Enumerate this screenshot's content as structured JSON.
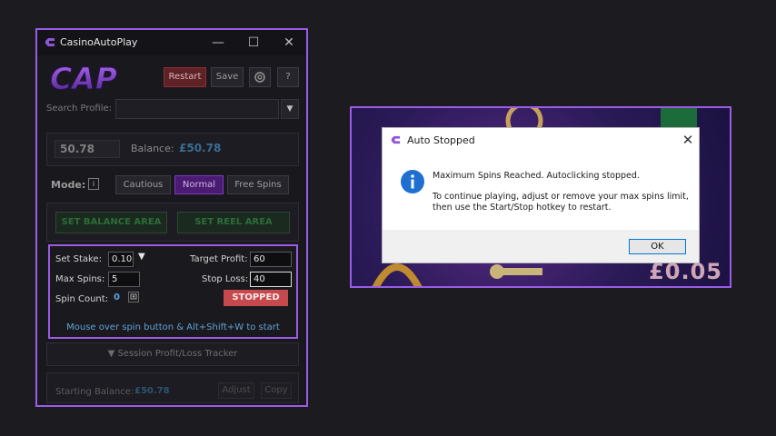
{
  "app": {
    "title": "CasinoAutoPlay",
    "logo_text": "CAP",
    "window_controls": {
      "minimize": "—",
      "maximize": "☐",
      "close": "✕"
    },
    "toolbar": {
      "restart": "Restart",
      "save": "Save",
      "gear_icon": "gear-icon",
      "help": "?"
    },
    "search": {
      "label": "Search Profile:",
      "value": "",
      "dropdown_icon": "▼"
    },
    "balance": {
      "box_value": "50.78",
      "label": "Balance:",
      "value": "£50.78"
    },
    "mode": {
      "label": "Mode:",
      "info": "i",
      "options": [
        "Cautious",
        "Normal",
        "Free Spins"
      ],
      "selected": "Normal"
    },
    "areas": {
      "balance_button": "SET BALANCE AREA",
      "reel_button": "SET REEL AREA"
    },
    "settings": {
      "stake_label": "Set Stake:",
      "stake_value": "0.10",
      "stake_dd_icon": "▼",
      "target_label": "Target Profit:",
      "target_value": "60",
      "max_spins_label": "Max Spins:",
      "max_spins_value": "5",
      "stop_loss_label": "Stop Loss:",
      "stop_loss_value": "40",
      "spin_count_label": "Spin Count:",
      "spin_count_value": "0",
      "status_button": "STOPPED",
      "hint": "Mouse over spin button & Alt+Shift+W to start"
    },
    "tracker": {
      "label": "▼ Session Profit/Loss Tracker"
    },
    "bottom": {
      "starting_label": "Starting Balance:",
      "starting_value": "£50.78",
      "adjust": "Adjust",
      "copy": "Copy"
    }
  },
  "game": {
    "prize_text": "£0.05"
  },
  "dialog": {
    "title": "Auto Stopped",
    "close": "✕",
    "message_line1": "Maximum Spins Reached. Autoclicking stopped.",
    "message_line2": "To continue playing, adjust or remove your max spins limit, then use the Start/Stop hotkey to restart.",
    "ok": "OK"
  },
  "colors": {
    "accent_purple": "#9a5ce6",
    "stopped_red": "#c6494d",
    "balance_blue": "#3a6d93",
    "hint_blue": "#5ea3d8",
    "area_green": "#2f6b3b"
  }
}
